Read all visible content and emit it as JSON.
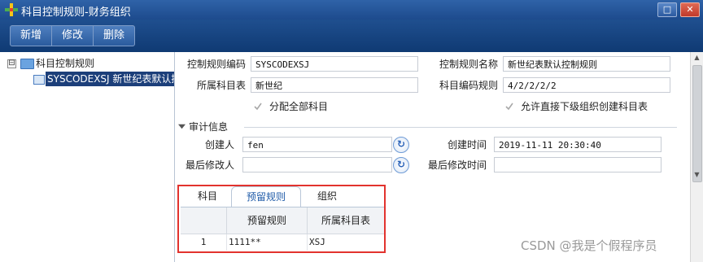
{
  "window": {
    "title": "科目控制规则-财务组织",
    "maximize_glyph": "□",
    "close_glyph": "✕"
  },
  "toolbar": {
    "new_label": "新增",
    "edit_label": "修改",
    "delete_label": "删除"
  },
  "tree": {
    "root_toggle": "⊟",
    "root_label": "科目控制规则",
    "child_label": "SYSCODEXSJ 新世纪表默认控制"
  },
  "form": {
    "rule_code_label": "控制规则编码",
    "rule_code_value": "SYSCODEXSJ",
    "rule_name_label": "控制规则名称",
    "rule_name_value": "新世纪表默认控制规则",
    "subject_table_label": "所属科目表",
    "subject_table_value": "新世纪",
    "code_rule_label": "科目编码规则",
    "code_rule_value": "4/2/2/2/2",
    "assign_all_label": "分配全部科目",
    "allow_sub_label": "允许直接下级组织创建科目表"
  },
  "audit": {
    "section_label": "审计信息",
    "creator_label": "创建人",
    "creator_value": "fen",
    "created_time_label": "创建时间",
    "created_time_value": "2019-11-11 20:30:40",
    "modifier_label": "最后修改人",
    "modifier_value": "",
    "modified_time_label": "最后修改时间",
    "modified_time_value": ""
  },
  "tabs": {
    "items": [
      "科目",
      "预留规则",
      "组织"
    ],
    "active": "预留规则"
  },
  "grid": {
    "columns": [
      "预留规则",
      "所属科目表"
    ],
    "rows": [
      {
        "index": "1",
        "rule": "1111**",
        "table": "XSJ"
      }
    ]
  },
  "watermark": "CSDN @我是个假程序员",
  "colors": {
    "accent": "#1d4b8d",
    "highlight_frame": "#e2332e",
    "selection": "#1c3f7a"
  }
}
